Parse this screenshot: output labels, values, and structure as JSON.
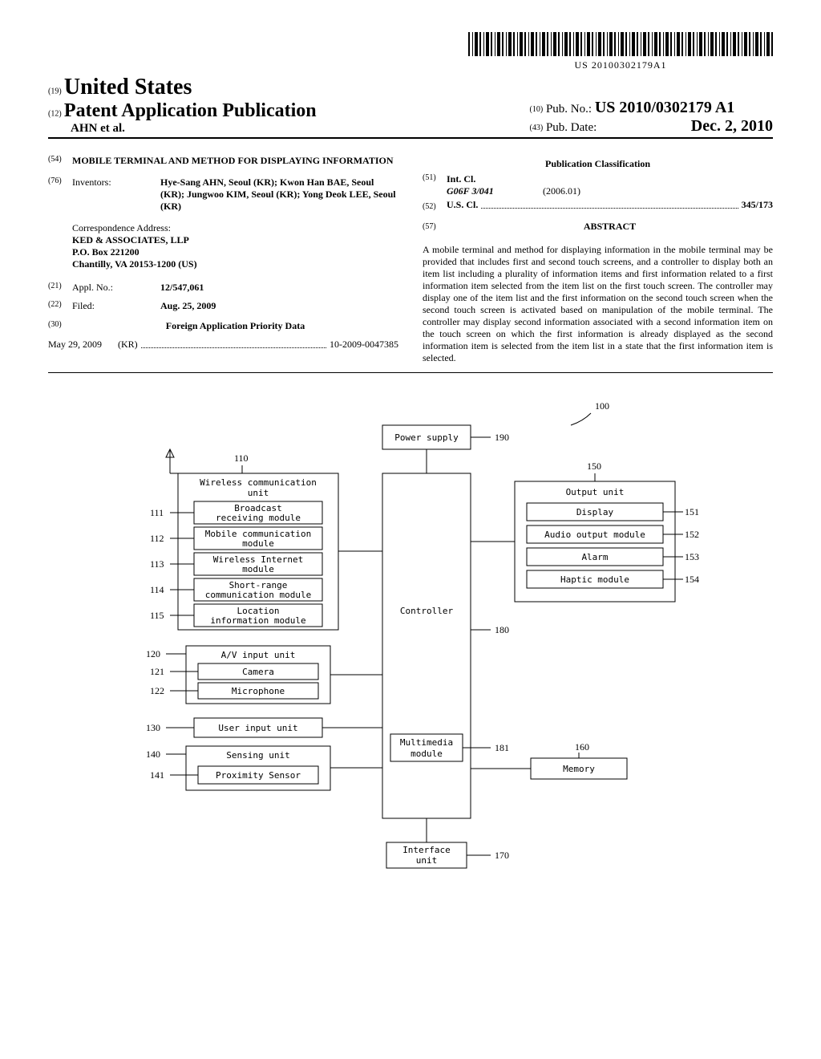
{
  "barcode_text": "US 20100302179A1",
  "header": {
    "n19": "(19)",
    "country": "United States",
    "n12": "(12)",
    "pub_type": "Patent Application Publication",
    "authors": "AHN et al.",
    "n10": "(10)",
    "pubno_label": "Pub. No.:",
    "pubno": "US 2010/0302179 A1",
    "n43": "(43)",
    "pubdate_label": "Pub. Date:",
    "pubdate": "Dec. 2, 2010"
  },
  "left": {
    "n54": "(54)",
    "title": "MOBILE TERMINAL AND METHOD FOR DISPLAYING INFORMATION",
    "n76": "(76)",
    "inventors_label": "Inventors:",
    "inventors": "Hye-Sang AHN, Seoul (KR); Kwon Han BAE, Seoul (KR); Jungwoo KIM, Seoul (KR); Yong Deok LEE, Seoul (KR)",
    "corr_label": "Correspondence Address:",
    "corr1": "KED & ASSOCIATES, LLP",
    "corr2": "P.O. Box 221200",
    "corr3": "Chantilly, VA 20153-1200 (US)",
    "n21": "(21)",
    "appl_label": "Appl. No.:",
    "appl": "12/547,061",
    "n22": "(22)",
    "filed_label": "Filed:",
    "filed": "Aug. 25, 2009",
    "n30": "(30)",
    "foreign_hdr": "Foreign Application Priority Data",
    "foreign_date": "May 29, 2009",
    "foreign_cc": "(KR)",
    "foreign_no": "10-2009-0047385"
  },
  "right": {
    "pubclass_hdr": "Publication Classification",
    "n51": "(51)",
    "intcl_label": "Int. Cl.",
    "intcl_code": "G06F 3/041",
    "intcl_year": "(2006.01)",
    "n52": "(52)",
    "uscl_label": "U.S. Cl.",
    "uscl": "345/173",
    "n57": "(57)",
    "abstract_hdr": "ABSTRACT",
    "abstract": "A mobile terminal and method for displaying information in the mobile terminal may be provided that includes first and second touch screens, and a controller to display both an item list including a plurality of information items and first information related to a first information item selected from the item list on the first touch screen. The controller may display one of the item list and the first information on the second touch screen when the second touch screen is activated based on manipulation of the mobile terminal. The controller may display second information associated with a second information item on the touch screen on which the first information is already displayed as the second information item is selected from the item list in a state that the first information item is selected."
  },
  "diagram": {
    "ref100": "100",
    "power": "Power supply",
    "n190": "190",
    "wcu_title1": "Wireless communication",
    "wcu_title2": "unit",
    "n110": "110",
    "broadcast1": "Broadcast",
    "broadcast2": "receiving module",
    "n111": "111",
    "mobile1": "Mobile communication",
    "mobile2": "module",
    "n112": "112",
    "internet1": "Wireless Internet",
    "internet2": "module",
    "n113": "113",
    "short1": "Short-range",
    "short2": "communication module",
    "n114": "114",
    "loc1": "Location",
    "loc2": "information module",
    "n115": "115",
    "av": "A/V input unit",
    "n120": "120",
    "camera": "Camera",
    "n121": "121",
    "mic": "Microphone",
    "n122": "122",
    "userinput": "User input unit",
    "n130": "130",
    "sensing": "Sensing unit",
    "n140": "140",
    "prox": "Proximity Sensor",
    "n141": "141",
    "controller": "Controller",
    "n180": "180",
    "multimedia1": "Multimedia",
    "multimedia2": "module",
    "n181": "181",
    "output": "Output unit",
    "n150": "150",
    "display": "Display",
    "n151": "151",
    "audio": "Audio output module",
    "n152": "152",
    "alarm": "Alarm",
    "n153": "153",
    "haptic": "Haptic module",
    "n154": "154",
    "memory": "Memory",
    "n160": "160",
    "interface1": "Interface",
    "interface2": "unit",
    "n170": "170"
  }
}
